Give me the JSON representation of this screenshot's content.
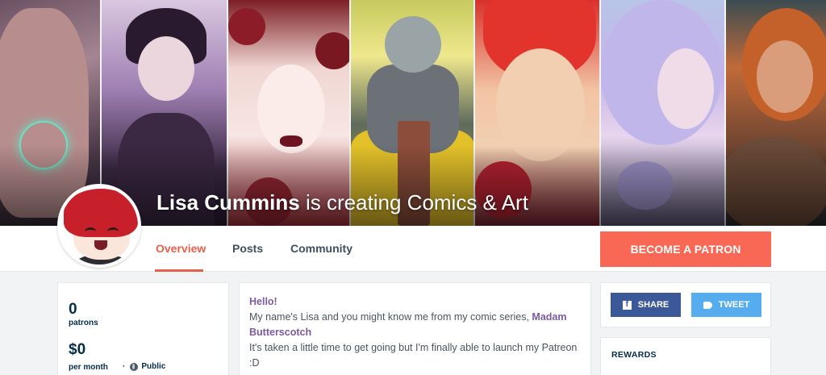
{
  "creator": {
    "name": "Lisa Cummins",
    "tagline": " is creating Comics & Art"
  },
  "nav": {
    "tabs": [
      {
        "label": "Overview",
        "active": true
      },
      {
        "label": "Posts",
        "active": false
      },
      {
        "label": "Community",
        "active": false
      }
    ],
    "cta": "BECOME A PATRON"
  },
  "stats": {
    "patrons_value": "0",
    "patrons_label": "patrons",
    "earnings_value": "$0",
    "earnings_label": "per month",
    "separator": "·",
    "visibility": "Public"
  },
  "about": {
    "greeting": "Hello!",
    "line1_prefix": "My name's Lisa and you might know me from my comic series, ",
    "series_link": "Madam Butterscotch",
    "line2": "It's taken a little time to get going but I'm finally able to launch my Patreon :D"
  },
  "share": {
    "facebook_label": "SHARE",
    "twitter_label": "TWEET"
  },
  "rewards": {
    "title": "REWARDS"
  },
  "colors": {
    "accent": "#f96854",
    "tab_active": "#e8604c",
    "facebook": "#3b5998",
    "twitter": "#55acee",
    "link_purple": "#7b5aa0"
  }
}
